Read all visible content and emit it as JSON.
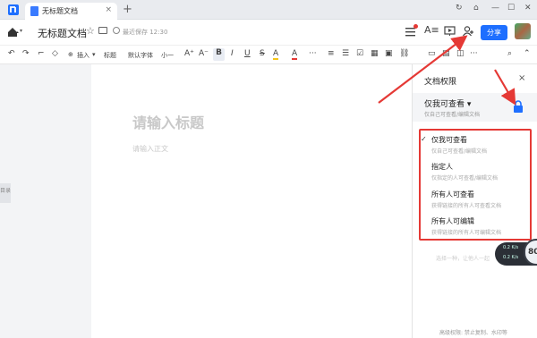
{
  "titlebar": {
    "tab_label": "无标题文档",
    "tab_close": "×",
    "new_tab": "+",
    "window_controls": [
      "↻",
      "⌂",
      "—",
      "☐",
      "✕"
    ]
  },
  "header": {
    "home_caret": "▾",
    "doc_title": "无标题文档",
    "saved_text": "最近保存 12:30",
    "share_label": "分享",
    "icons": [
      "menu-icon",
      "font-icon",
      "present-icon",
      "add-collaborator-icon"
    ]
  },
  "toolbar": {
    "undo": "↶",
    "redo": "↷",
    "format_painter": "⌐",
    "clear": "◇",
    "insert": "插入",
    "insert_caret": "▾",
    "heading": "标题",
    "font": "默认字体",
    "size": "小一",
    "grow": "A⁺",
    "shrink": "A⁻",
    "bold": "B",
    "italic": "I",
    "underline": "U",
    "strike": "S",
    "highlight": "A",
    "color": "A",
    "more": "···",
    "search": "⌕",
    "collapse": "⌃"
  },
  "editor": {
    "title_placeholder": "请输入标题",
    "body_placeholder": "请输入正文",
    "side_tab": "目录"
  },
  "permissions": {
    "title": "文档权限",
    "close": "×",
    "current_label": "仅我可查看 ▾",
    "current_sub": "仅自己可查看/编辑文档",
    "options": [
      {
        "label": "仅我可查看",
        "sub": "仅自己可查看/编辑文档",
        "checked": "✓"
      },
      {
        "label": "指定人",
        "sub": "仅指定的人可查看/编辑文档",
        "checked": ""
      },
      {
        "label": "所有人可查看",
        "sub": "获得链接的所有人可查看文档",
        "checked": ""
      },
      {
        "label": "所有人可编辑",
        "sub": "获得链接的所有人可编辑文档",
        "checked": ""
      }
    ],
    "link_note": "选择一种，让他人一起",
    "bottom_note": "高级权限: 禁止复制、水印等"
  },
  "speed_widget": {
    "up": "0.2 K/s",
    "down": "0.2 K/s",
    "value": "80"
  },
  "colors": {
    "accent": "#1e6fff",
    "annotation_red": "#e53935",
    "lock": "#1e6fff"
  }
}
